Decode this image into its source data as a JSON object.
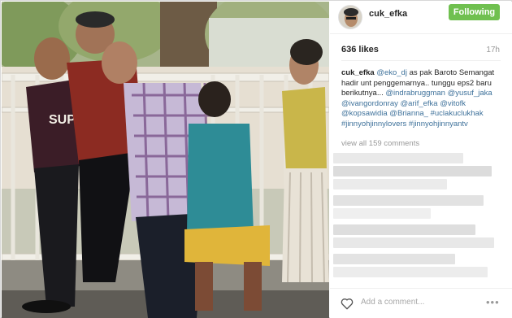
{
  "post": {
    "username": "cuk_efka",
    "follow_label": "Following",
    "likes": "636 likes",
    "time_ago": "17h",
    "view_all": "view all 159 comments",
    "add_comment_placeholder": "Add a comment...",
    "more_label": "•••"
  },
  "caption": {
    "author": "cuk_efka",
    "tokens": [
      {
        "text": "@eko_dj",
        "link": true
      },
      {
        "text": " as pak Baroto Semangat hadir unt penggemarnya.. tunggu eps2 baru berikutnya... ",
        "link": false
      },
      {
        "text": "@indrabruggman",
        "link": true
      },
      {
        "text": " ",
        "link": false
      },
      {
        "text": "@yusuf_jaka",
        "link": true
      },
      {
        "text": " ",
        "link": false
      },
      {
        "text": "@ivangordonray",
        "link": true
      },
      {
        "text": " ",
        "link": false
      },
      {
        "text": "@arif_efka",
        "link": true
      },
      {
        "text": " ",
        "link": false
      },
      {
        "text": "@vitofk",
        "link": true
      },
      {
        "text": " ",
        "link": false
      },
      {
        "text": "@kopsawidia",
        "link": true
      },
      {
        "text": " ",
        "link": false
      },
      {
        "text": "@Brianna_",
        "link": true
      },
      {
        "text": " ",
        "link": false
      },
      {
        "text": "#uclakuclukhak",
        "link": true
      },
      {
        "text": " ",
        "link": false
      },
      {
        "text": "#jinnyohjinnylovers",
        "link": true
      },
      {
        "text": " ",
        "link": false
      },
      {
        "text": "#jinnyohjinnyantv",
        "link": true
      }
    ]
  },
  "colors": {
    "follow_button": "#70c050",
    "link": "#3f729b",
    "username": "#262626",
    "muted": "#999999"
  },
  "icons": [
    "avatar",
    "heart-icon",
    "more-options-icon"
  ]
}
